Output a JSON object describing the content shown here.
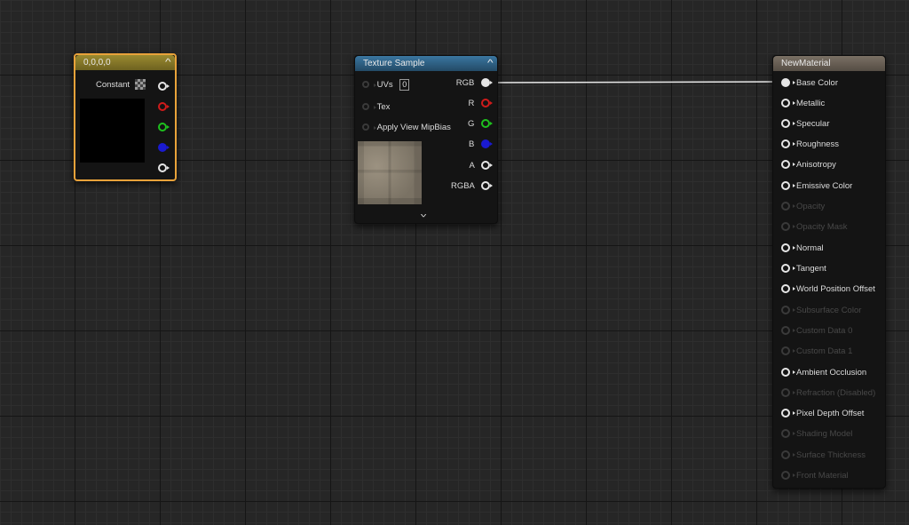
{
  "constant_node": {
    "title": "0,0,0,0",
    "constant_label": "Constant",
    "header_color": "#8a7a28",
    "border_color": "#e8a23a",
    "preview_color": "#000000"
  },
  "texture_node": {
    "title": "Texture Sample",
    "header_color": "#2f5f7e",
    "inputs": [
      {
        "label": "UVs",
        "value": "0"
      },
      {
        "label": "Tex"
      },
      {
        "label": "Apply View MipBias"
      }
    ],
    "outputs": [
      {
        "label": "RGB",
        "color": "#ffffff"
      },
      {
        "label": "R",
        "color": "#d01b1b"
      },
      {
        "label": "G",
        "color": "#1ec11e"
      },
      {
        "label": "B",
        "color": "#1a1ad0"
      },
      {
        "label": "A",
        "color": "#d8d8d8"
      },
      {
        "label": "RGBA",
        "color": "#d8d8d8"
      }
    ],
    "expand_icon": "chevron-down-icon"
  },
  "material_node": {
    "title": "NewMaterial",
    "header_color": "#6b6258",
    "pins": [
      {
        "label": "Base Color",
        "enabled": true
      },
      {
        "label": "Metallic",
        "enabled": true
      },
      {
        "label": "Specular",
        "enabled": true
      },
      {
        "label": "Roughness",
        "enabled": true
      },
      {
        "label": "Anisotropy",
        "enabled": true
      },
      {
        "label": "Emissive Color",
        "enabled": true
      },
      {
        "label": "Opacity",
        "enabled": false
      },
      {
        "label": "Opacity Mask",
        "enabled": false
      },
      {
        "label": "Normal",
        "enabled": true
      },
      {
        "label": "Tangent",
        "enabled": true
      },
      {
        "label": "World Position Offset",
        "enabled": true
      },
      {
        "label": "Subsurface Color",
        "enabled": false
      },
      {
        "label": "Custom Data 0",
        "enabled": false
      },
      {
        "label": "Custom Data 1",
        "enabled": false
      },
      {
        "label": "Ambient Occlusion",
        "enabled": true
      },
      {
        "label": "Refraction (Disabled)",
        "enabled": false
      },
      {
        "label": "Pixel Depth Offset",
        "enabled": true
      },
      {
        "label": "Shading Model",
        "enabled": false
      },
      {
        "label": "Surface Thickness",
        "enabled": false
      },
      {
        "label": "Front Material",
        "enabled": false
      }
    ]
  }
}
